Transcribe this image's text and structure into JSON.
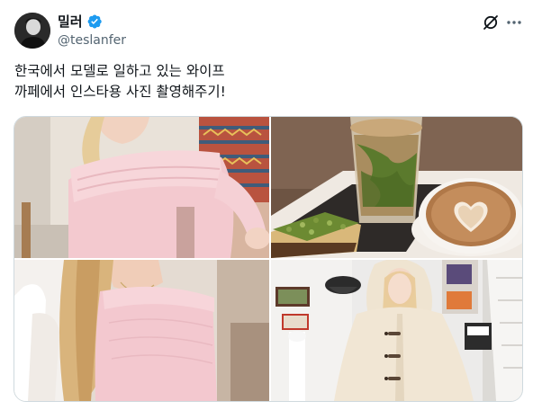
{
  "author": {
    "display_name": "밀러",
    "handle": "@teslanfer",
    "verified": true
  },
  "tweet": {
    "lines": [
      "한국에서 모델로 일하고 있는 와이프",
      "까페에서 인스타용 사진 촬영해주기!"
    ]
  },
  "icons": {
    "verified": "verified-badge-icon",
    "grok": "grok-icon",
    "more": "more-options-icon"
  },
  "colors": {
    "verified_blue": "#1d9bf0",
    "text_primary": "#0f1419",
    "text_secondary": "#536471",
    "border": "#cfd9de"
  },
  "media": [
    {
      "subject": "woman in pink off-shoulder sweater"
    },
    {
      "subject": "iced drink, latte with heart art, pistachio cake"
    },
    {
      "subject": "woman in pink sweater, side view"
    },
    {
      "subject": "woman in beige hooded coat"
    }
  ]
}
